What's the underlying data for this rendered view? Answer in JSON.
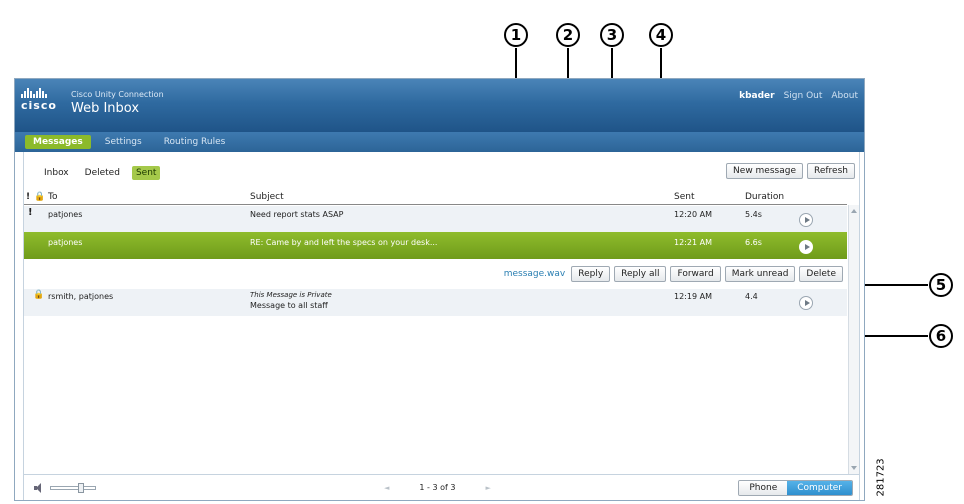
{
  "header": {
    "product": "Cisco Unity Connection",
    "title": "Web Inbox",
    "logo": "cisco",
    "user": "kbader",
    "links": [
      "Sign Out",
      "About"
    ]
  },
  "nav": [
    "Messages",
    "Settings",
    "Routing Rules"
  ],
  "folders": [
    "Inbox",
    "Deleted",
    "Sent"
  ],
  "toolbar": {
    "new_message": "New message",
    "refresh": "Refresh"
  },
  "columns": {
    "to": "To",
    "subject": "Subject",
    "sent": "Sent",
    "duration": "Duration"
  },
  "messages": [
    {
      "flag": "!",
      "to": "patjones",
      "subject": "Need report stats ASAP",
      "sent": "12:20 AM",
      "duration": "5.4s"
    },
    {
      "to": "patjones",
      "subject": "RE: Came by and left the specs on your desk...",
      "sent": "12:21 AM",
      "duration": "6.6s"
    },
    {
      "to": "rsmith, patjones",
      "private_note": "This Message is Private",
      "subject": "Message to all staff",
      "sent": "12:19 AM",
      "duration": "4.4"
    }
  ],
  "actions": {
    "attachment": "message.wav",
    "reply": "Reply",
    "reply_all": "Reply all",
    "forward": "Forward",
    "mark_unread": "Mark unread",
    "delete": "Delete"
  },
  "footer": {
    "pager": "1 - 3 of 3",
    "phone": "Phone",
    "computer": "Computer"
  },
  "callouts": [
    "1",
    "2",
    "3",
    "4",
    "5",
    "6"
  ],
  "figure_id": "281723"
}
